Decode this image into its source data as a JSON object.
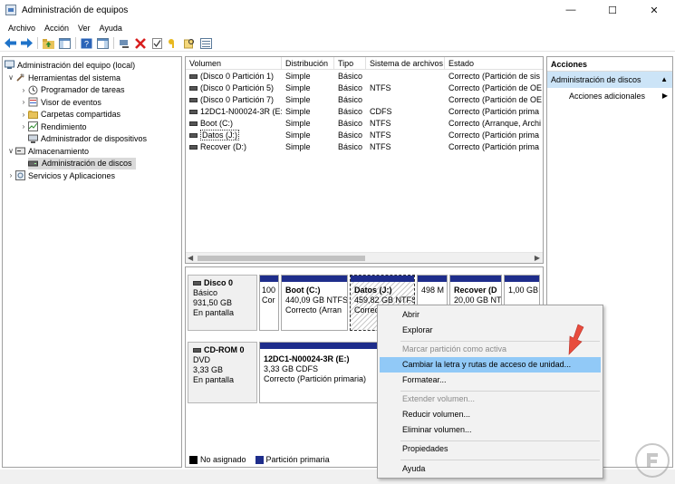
{
  "window": {
    "title": "Administración de equipos",
    "controls": [
      "minimize-icon",
      "maximize-icon",
      "close-icon"
    ]
  },
  "menubar": [
    "Archivo",
    "Acción",
    "Ver",
    "Ayuda"
  ],
  "toolbar_icons": [
    "back-arrow-icon",
    "forward-arrow-icon",
    "up-folder-icon",
    "show-hide-tree-icon",
    "help-icon",
    "properties-pane-icon",
    "connect-icon",
    "delete-icon",
    "check-properties-icon",
    "key-icon",
    "search-icon",
    "list-view-icon"
  ],
  "tree": {
    "root": "Administración del equipo (local)",
    "items": [
      {
        "label": "Herramientas del sistema",
        "level": 1,
        "expander": "v",
        "icon": "tools-icon"
      },
      {
        "label": "Programador de tareas",
        "level": 2,
        "expander": ">",
        "icon": "clock-icon"
      },
      {
        "label": "Visor de eventos",
        "level": 2,
        "expander": ">",
        "icon": "event-viewer-icon"
      },
      {
        "label": "Carpetas compartidas",
        "level": 2,
        "expander": ">",
        "icon": "shared-folder-icon"
      },
      {
        "label": "Rendimiento",
        "level": 2,
        "expander": ">",
        "icon": "performance-icon"
      },
      {
        "label": "Administrador de dispositivos",
        "level": 2,
        "expander": "",
        "icon": "device-manager-icon"
      },
      {
        "label": "Almacenamiento",
        "level": 1,
        "expander": "v",
        "icon": "storage-icon"
      },
      {
        "label": "Administración de discos",
        "level": 2,
        "expander": "",
        "icon": "disk-icon",
        "selected": true
      },
      {
        "label": "Servicios y Aplicaciones",
        "level": 1,
        "expander": ">",
        "icon": "services-icon"
      }
    ]
  },
  "volumes": {
    "columns": [
      "Volumen",
      "Distribución",
      "Tipo",
      "Sistema de archivos",
      "Estado"
    ],
    "rows": [
      {
        "volumen": "(Disco 0 Partición 1)",
        "distribucion": "Simple",
        "tipo": "Básico",
        "fs": "",
        "estado": "Correcto (Partición de sis"
      },
      {
        "volumen": "(Disco 0 Partición 5)",
        "distribucion": "Simple",
        "tipo": "Básico",
        "fs": "NTFS",
        "estado": "Correcto (Partición de OE"
      },
      {
        "volumen": "(Disco 0 Partición 7)",
        "distribucion": "Simple",
        "tipo": "Básico",
        "fs": "",
        "estado": "Correcto (Partición de OE"
      },
      {
        "volumen": "12DC1-N00024-3R (E:)",
        "distribucion": "Simple",
        "tipo": "Básico",
        "fs": "CDFS",
        "estado": "Correcto (Partición prima"
      },
      {
        "volumen": "Boot (C:)",
        "distribucion": "Simple",
        "tipo": "Básico",
        "fs": "NTFS",
        "estado": "Correcto (Arranque, Archi"
      },
      {
        "volumen": "Datos (J:)",
        "distribucion": "Simple",
        "tipo": "Básico",
        "fs": "NTFS",
        "estado": "Correcto (Partición prima"
      },
      {
        "volumen": "Recover (D:)",
        "distribucion": "Simple",
        "tipo": "Básico",
        "fs": "NTFS",
        "estado": "Correcto (Partición prima"
      }
    ]
  },
  "disks": [
    {
      "name": "Disco 0",
      "type": "Básico",
      "size": "931,50 GB",
      "status": "En pantalla",
      "partitions": [
        {
          "l1": "100",
          "l2": "Cor",
          "l3": ""
        },
        {
          "l1": "Boot  (C:)",
          "l2": "440,09 GB NTFS",
          "l3": "Correcto (Arran"
        },
        {
          "l1": "Datos  (J:)",
          "l2": "459,82 GB NTFS",
          "l3": "Correc"
        },
        {
          "l1": "498 M",
          "l2": "",
          "l3": ""
        },
        {
          "l1": "Recover  (D",
          "l2": "20,00 GB NTFS",
          "l3": ""
        },
        {
          "l1": "1,00 GB",
          "l2": "",
          "l3": ""
        }
      ]
    },
    {
      "name": "CD-ROM 0",
      "type": "DVD",
      "size": "3,33 GB",
      "status": "En pantalla",
      "partitions": [
        {
          "l1": "12DC1-N00024-3R  (E:)",
          "l2": "3,33 GB CDFS",
          "l3": "Correcto (Partición primaria)"
        }
      ]
    }
  ],
  "legend": [
    {
      "label": "No asignado",
      "color": "#000000"
    },
    {
      "label": "Partición primaria",
      "color": "#1e2d8b"
    }
  ],
  "actions": {
    "header": "Acciones",
    "section": "Administración de discos",
    "item": "Acciones adicionales"
  },
  "context_menu": [
    {
      "label": "Abrir",
      "state": "enabled"
    },
    {
      "label": "Explorar",
      "state": "enabled"
    },
    {
      "label": "Marcar partición como activa",
      "state": "disabled"
    },
    {
      "label": "Cambiar la letra y rutas de acceso de unidad...",
      "state": "highlighted"
    },
    {
      "label": "Formatear...",
      "state": "enabled"
    },
    {
      "label": "Extender volumen...",
      "state": "disabled"
    },
    {
      "label": "Reducir volumen...",
      "state": "enabled"
    },
    {
      "label": "Eliminar volumen...",
      "state": "enabled"
    },
    {
      "label": "Propiedades",
      "state": "enabled"
    },
    {
      "label": "Ayuda",
      "state": "enabled"
    }
  ],
  "colors": {
    "accent_blue": "#1e2d8b",
    "highlight": "#91c9f7",
    "arrow_red": "#e84c3d",
    "actions_section_bg": "#cce4f7"
  }
}
